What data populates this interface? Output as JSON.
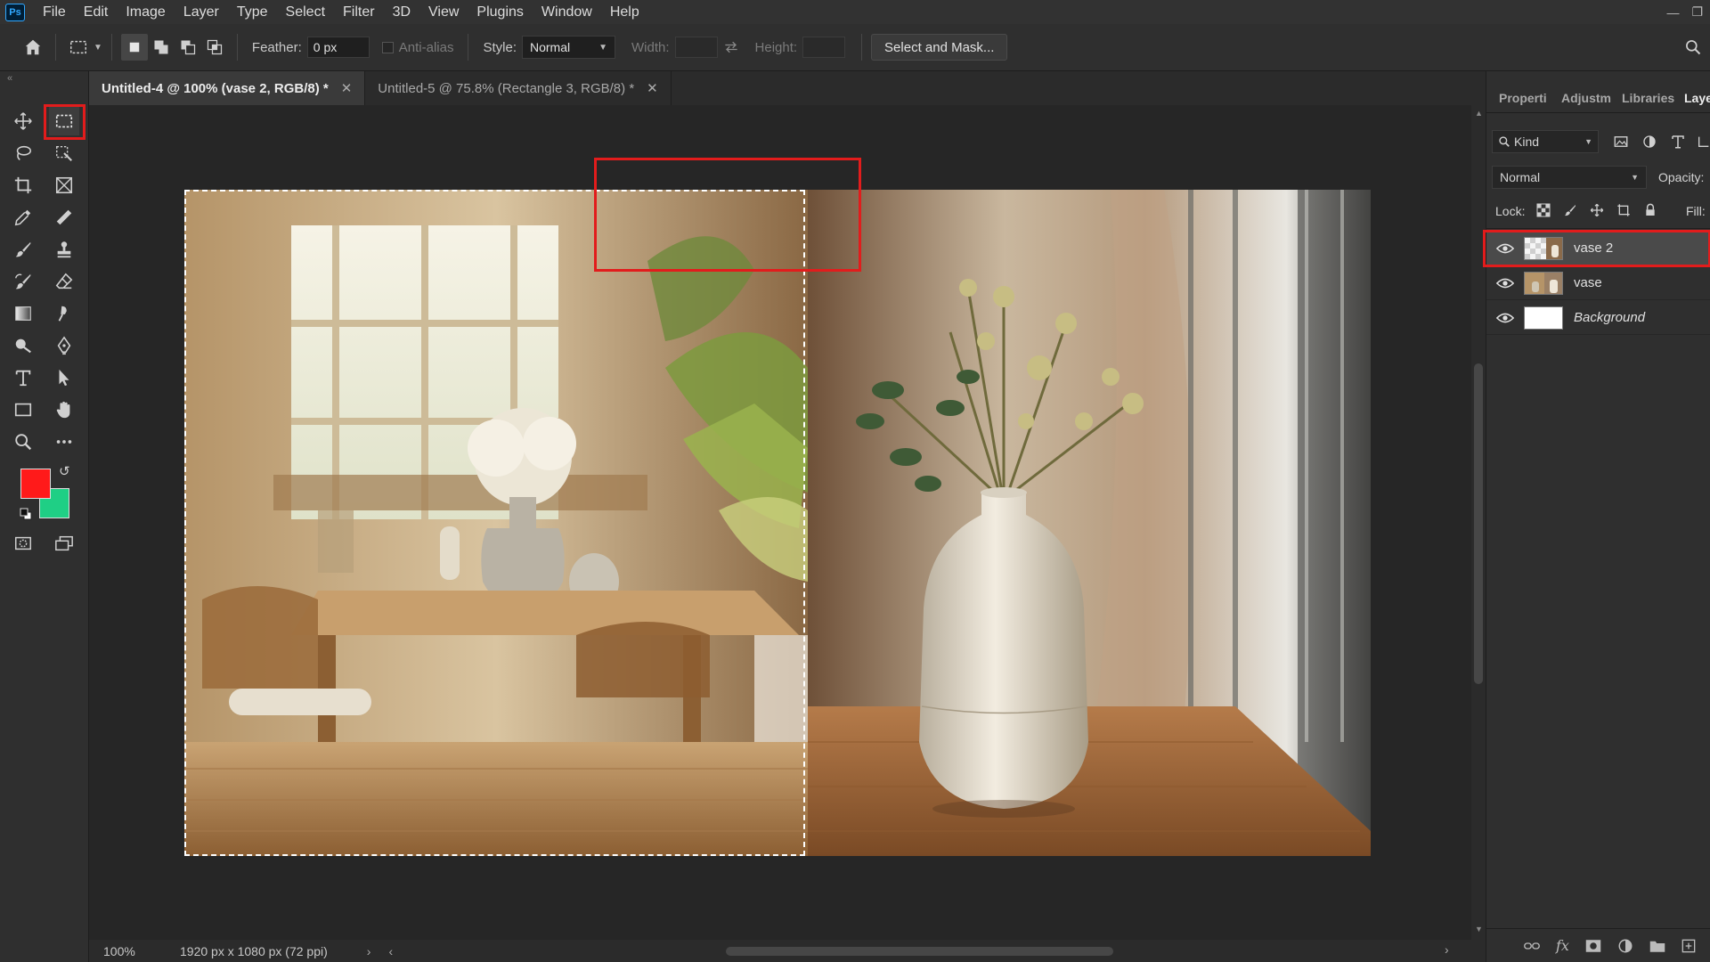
{
  "app": {
    "logo": "Ps"
  },
  "menu": [
    "File",
    "Edit",
    "Image",
    "Layer",
    "Type",
    "Select",
    "Filter",
    "3D",
    "View",
    "Plugins",
    "Window",
    "Help"
  ],
  "options": {
    "feather_label": "Feather:",
    "feather_value": "0 px",
    "anti_alias_label": "Anti-alias",
    "style_label": "Style:",
    "style_value": "Normal",
    "width_label": "Width:",
    "height_label": "Height:",
    "select_mask_label": "Select and Mask..."
  },
  "tabs": [
    {
      "label": "Untitled-4 @ 100% (vase 2, RGB/8) *",
      "active": true
    },
    {
      "label": "Untitled-5 @ 75.8% (Rectangle 3, RGB/8) *",
      "active": false
    }
  ],
  "status": {
    "zoom": "100%",
    "doc_info": "1920 px x 1080 px (72 ppi)"
  },
  "colors": {
    "foreground": "#ff1a1a",
    "background": "#1fcf85",
    "highlight": "#e21c1c"
  },
  "panel": {
    "tabs": [
      "Properti",
      "Adjustm",
      "Libraries",
      "Laye"
    ],
    "kind_label": "Kind",
    "blend_mode": "Normal",
    "opacity_label": "Opacity:",
    "lock_label": "Lock:",
    "fill_label": "Fill:"
  },
  "layers": [
    {
      "name": "vase 2",
      "selected": true
    },
    {
      "name": "vase",
      "selected": false
    },
    {
      "name": "Background",
      "selected": false
    }
  ]
}
